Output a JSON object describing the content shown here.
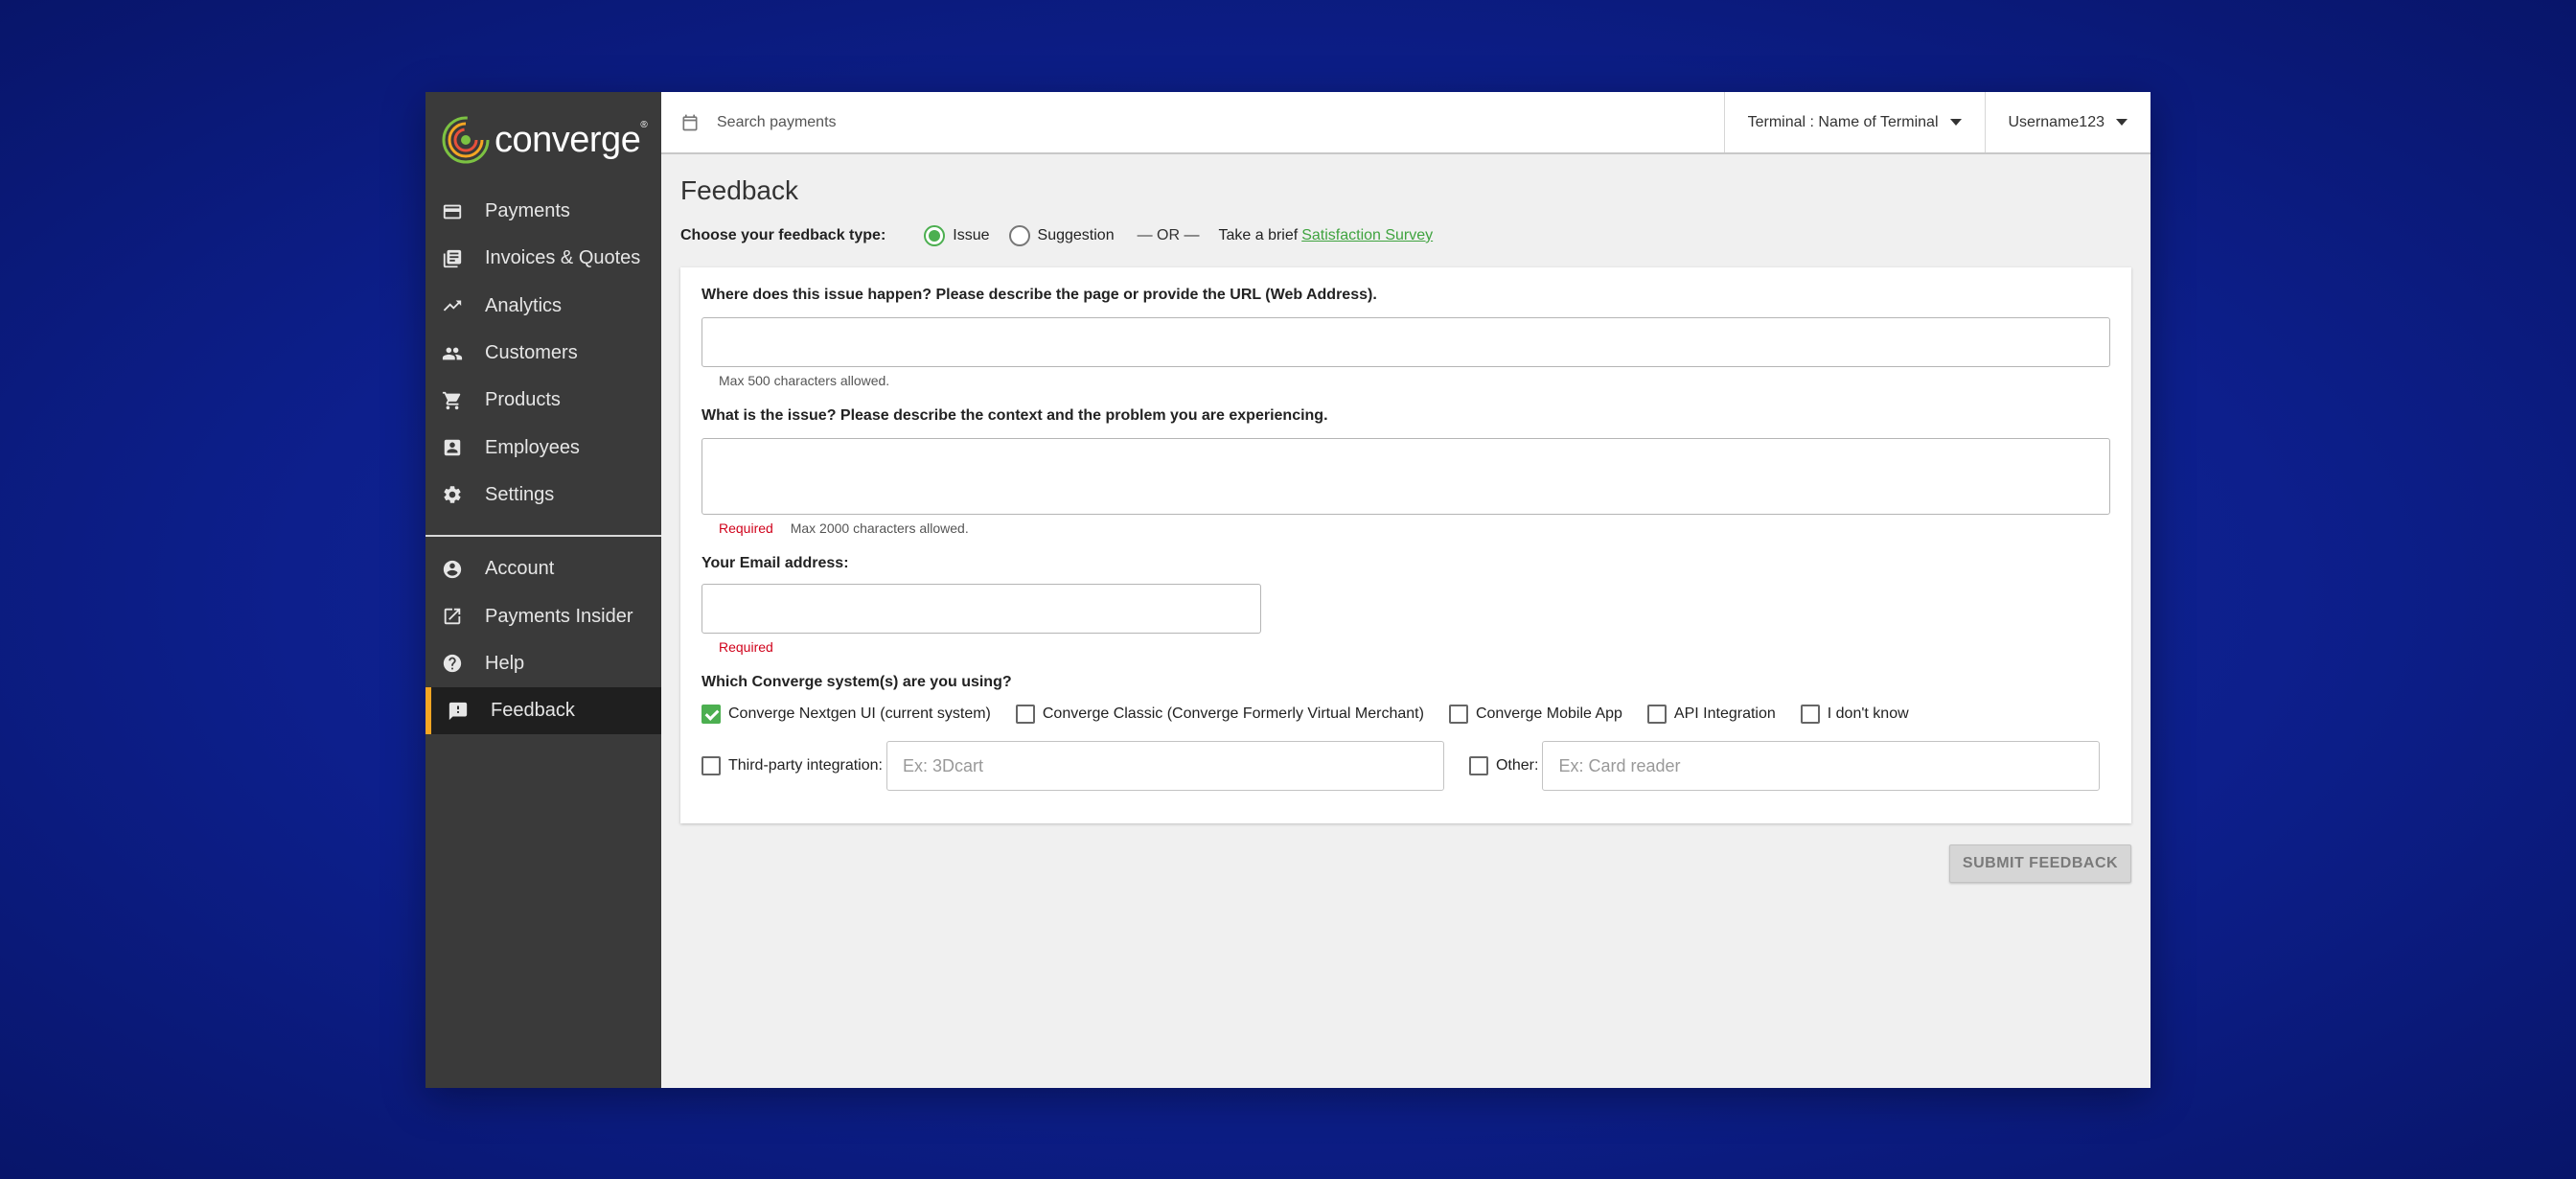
{
  "brand": {
    "name": "converge",
    "reg": "®"
  },
  "sidebar": {
    "items": [
      {
        "label": "Payments",
        "icon": "credit-card-icon"
      },
      {
        "label": "Invoices & Quotes",
        "icon": "invoices-icon"
      },
      {
        "label": "Analytics",
        "icon": "trending-up-icon"
      },
      {
        "label": "Customers",
        "icon": "people-icon"
      },
      {
        "label": "Products",
        "icon": "cart-icon"
      },
      {
        "label": "Employees",
        "icon": "badge-icon"
      },
      {
        "label": "Settings",
        "icon": "gear-icon"
      }
    ],
    "secondary": [
      {
        "label": "Account",
        "icon": "account-circle-icon"
      },
      {
        "label": "Payments Insider",
        "icon": "external-link-icon"
      },
      {
        "label": "Help",
        "icon": "help-icon"
      },
      {
        "label": "Feedback",
        "icon": "feedback-icon",
        "active": true
      }
    ],
    "active_accent": "#f5a623"
  },
  "topbar": {
    "search_placeholder": "Search payments",
    "terminal_label": "Terminal : Name of Terminal",
    "user_label": "Username123"
  },
  "page": {
    "title": "Feedback",
    "feedback_type_label": "Choose your feedback type:",
    "options": {
      "issue": "Issue",
      "suggestion": "Suggestion",
      "selected": "issue"
    },
    "or_text": "— OR —",
    "survey_prefix": "Take a brief",
    "survey_link": "Satisfaction Survey"
  },
  "form": {
    "where_label": "Where does this issue happen? Please describe the page or provide the URL (Web Address).",
    "where_hint": "Max 500 characters allowed.",
    "what_label": "What is the issue? Please describe the context and the problem you are experiencing.",
    "what_required": "Required",
    "what_hint": "Max 2000 characters allowed.",
    "email_label": "Your Email address:",
    "email_required": "Required",
    "systems_label": "Which Converge system(s) are you using?",
    "systems": [
      {
        "label": "Converge Nextgen UI (current system)",
        "checked": true
      },
      {
        "label": "Converge Classic (Converge Formerly Virtual Merchant)",
        "checked": false
      },
      {
        "label": "Converge Mobile App",
        "checked": false
      },
      {
        "label": "API Integration",
        "checked": false
      },
      {
        "label": "I don't know",
        "checked": false
      }
    ],
    "third_party_label": "Third-party integration:",
    "third_party_placeholder": "Ex: 3Dcart",
    "other_label": "Other:",
    "other_placeholder": "Ex: Card reader",
    "submit_label": "SUBMIT FEEDBACK"
  },
  "colors": {
    "accent_green": "#4caf50",
    "required_red": "#d0021b",
    "sidebar_bg": "#3a3a3a"
  }
}
